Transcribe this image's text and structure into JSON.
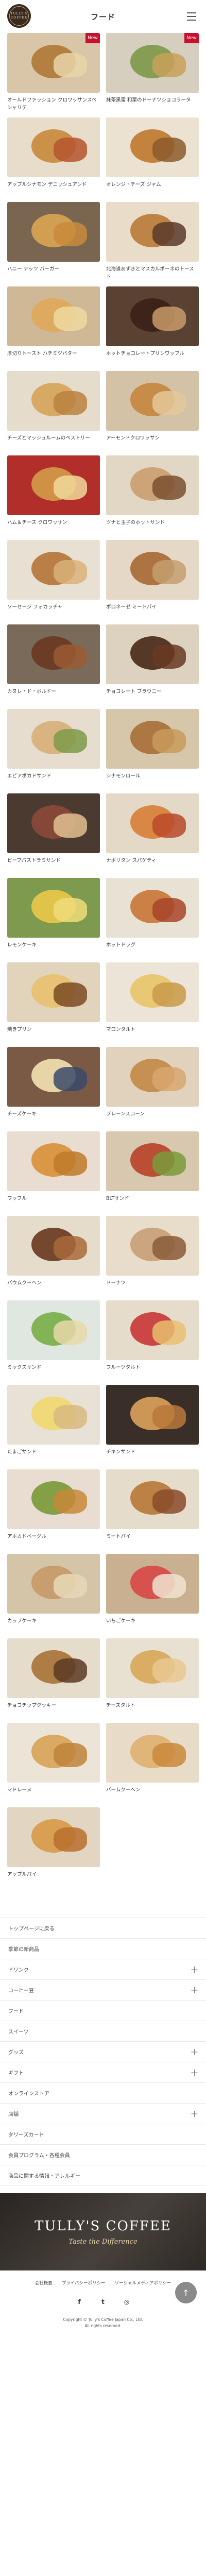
{
  "header": {
    "logo_text": "TULLY'S COFFEE",
    "title": "フード"
  },
  "products": [
    {
      "name": "オールドファッション クロワッサンスペシャリテ",
      "badge": "New",
      "bg": "#d9c6a8",
      "c1": "#b07a3a",
      "c2": "#e7d5a8"
    },
    {
      "name": "抹茶黒蜜 和栗のドーナツショコラータ",
      "badge": "New",
      "bg": "#d6cfbf",
      "c1": "#7e9a4a",
      "c2": "#c9a05a"
    },
    {
      "name": "アップルシナモン デニッシュアンド",
      "badge": "",
      "bg": "#e8dccb",
      "c1": "#c98a3e",
      "c2": "#b5552e"
    },
    {
      "name": "オレンジ・チーズ ジャム",
      "badge": "",
      "bg": "#ece2d2",
      "c1": "#c07a32",
      "c2": "#8c5a2a"
    },
    {
      "name": "ハニー ナッツ バーガー",
      "badge": "",
      "bg": "#7a6650",
      "c1": "#d8a452",
      "c2": "#c88a3a"
    },
    {
      "name": "北海道あずきとマスカルポーネのトースト",
      "badge": "",
      "bg": "#e9ddca",
      "c1": "#b87c3a",
      "c2": "#5a3a2a"
    },
    {
      "name": "厚切りトースト ハチミツバター",
      "badge": "",
      "bg": "#cfb896",
      "c1": "#e0a85a",
      "c2": "#f0d9a0"
    },
    {
      "name": "ホットチョコレートプリンワッフル",
      "badge": "",
      "bg": "#5a4232",
      "c1": "#3a2218",
      "c2": "#c89a6a"
    },
    {
      "name": "チーズとマッシュルームのペストリー",
      "badge": "",
      "bg": "#e6dccc",
      "c1": "#d7a45c",
      "c2": "#b8823e"
    },
    {
      "name": "アーモンドクロワッサン",
      "badge": "",
      "bg": "#d4c2a6",
      "c1": "#c48840",
      "c2": "#e4c89a"
    },
    {
      "name": "ハム＆チーズ クロワッサン",
      "badge": "",
      "bg": "#b22e2a",
      "c1": "#d39a4a",
      "c2": "#f1d89a"
    },
    {
      "name": "ツナと玉子のホットサンド",
      "badge": "",
      "bg": "#e2d6c4",
      "c1": "#caa070",
      "c2": "#7a5030"
    },
    {
      "name": "ソーセージ フォカッチャ",
      "badge": "",
      "bg": "#e8e0d2",
      "c1": "#b4763a",
      "c2": "#d9b27a"
    },
    {
      "name": "ボロネーゼ ミートパイ",
      "badge": "",
      "bg": "#e5d8c6",
      "c1": "#a86a34",
      "c2": "#c4a070"
    },
    {
      "name": "カヌレ・ド・ボルドー",
      "badge": "",
      "bg": "#7a6a5a",
      "c1": "#6a3a22",
      "c2": "#9a5a32"
    },
    {
      "name": "チョコレート ブラウニー",
      "badge": "",
      "bg": "#ddd2c0",
      "c1": "#4a2a1a",
      "c2": "#6a3a22"
    },
    {
      "name": "エビアボカドサンド",
      "badge": "",
      "bg": "#e6ddcf",
      "c1": "#d8b07a",
      "c2": "#7c9a4a"
    },
    {
      "name": "シナモンロール",
      "badge": "",
      "bg": "#d6c6aa",
      "c1": "#a8703a",
      "c2": "#c89a5a"
    },
    {
      "name": "ビーフパストラミサンド",
      "badge": "",
      "bg": "#4a3a30",
      "c1": "#8a4a3a",
      "c2": "#e0c090"
    },
    {
      "name": "ナポリタン スパゲティ",
      "badge": "",
      "bg": "#e4d8c6",
      "c1": "#d8803a",
      "c2": "#b84a2a"
    },
    {
      "name": "レモンケーキ",
      "badge": "",
      "bg": "#7e9a4e",
      "c1": "#e8c84a",
      "c2": "#f0dc7a"
    },
    {
      "name": "ホットドッグ",
      "badge": "",
      "bg": "#e8e2d4",
      "c1": "#c8783a",
      "c2": "#a8442a"
    },
    {
      "name": "焼きプリン",
      "badge": "",
      "bg": "#e2d4bc",
      "c1": "#e8c070",
      "c2": "#7a4a22"
    },
    {
      "name": "マロンタルト",
      "badge": "",
      "bg": "#ece4d6",
      "c1": "#e8c66a",
      "c2": "#c89a4a"
    },
    {
      "name": "チーズケーキ",
      "badge": "",
      "bg": "#7a5a44",
      "c1": "#f0e0b0",
      "c2": "#3a4a6a"
    },
    {
      "name": "プレーンスコーン",
      "badge": "",
      "bg": "#e0d2bc",
      "c1": "#c48a4a",
      "c2": "#d8a870"
    },
    {
      "name": "ワッフル",
      "badge": "",
      "bg": "#e8ddd0",
      "c1": "#d8903a",
      "c2": "#c07a2a"
    },
    {
      "name": "BLTサンド",
      "badge": "",
      "bg": "#d8c8b0",
      "c1": "#b8442a",
      "c2": "#7a9a3a"
    },
    {
      "name": "バウムクーヘン",
      "badge": "",
      "bg": "#e6dccc",
      "c1": "#6a3a22",
      "c2": "#a86a3a"
    },
    {
      "name": "ドーナツ",
      "badge": "",
      "bg": "#e8dccb",
      "c1": "#c8a07a",
      "c2": "#8a5a3a"
    },
    {
      "name": "ミックスサンド",
      "badge": "",
      "bg": "#e0e6e0",
      "c1": "#7ab04a",
      "c2": "#e8d8a8"
    },
    {
      "name": "フルーツタルト",
      "badge": "",
      "bg": "#e6dccc",
      "c1": "#c83a3a",
      "c2": "#e8c070"
    },
    {
      "name": "たまごサンド",
      "badge": "",
      "bg": "#e8e2d6",
      "c1": "#f0d870",
      "c2": "#d8b880"
    },
    {
      "name": "チキンサンド",
      "badge": "",
      "bg": "#3a2e28",
      "c1": "#d8a05a",
      "c2": "#b8783a"
    },
    {
      "name": "アボカドベーグル",
      "badge": "",
      "bg": "#e8ddd0",
      "c1": "#7a9a3a",
      "c2": "#c8883a"
    },
    {
      "name": "ミートパイ",
      "badge": "",
      "bg": "#e6dccc",
      "c1": "#b8783a",
      "c2": "#8a4a2a"
    },
    {
      "name": "カップケーキ",
      "badge": "",
      "bg": "#d4c4a8",
      "c1": "#c89a6a",
      "c2": "#e8d8b8"
    },
    {
      "name": "いちごケーキ",
      "badge": "",
      "bg": "#c8b090",
      "c1": "#d84a4a",
      "c2": "#f0e4d0"
    },
    {
      "name": "チョコチップクッキー",
      "badge": "",
      "bg": "#e6dccc",
      "c1": "#a8743a",
      "c2": "#5a3a22"
    },
    {
      "name": "チーズタルト",
      "badge": "",
      "bg": "#e8e0d0",
      "c1": "#d8a85a",
      "c2": "#e8c890"
    },
    {
      "name": "マドレーヌ",
      "badge": "",
      "bg": "#ece4d6",
      "c1": "#d8a45a",
      "c2": "#c0843a"
    },
    {
      "name": "バームクーヘン",
      "badge": "",
      "bg": "#e8dcc8",
      "c1": "#e0b070",
      "c2": "#c8883a"
    }
  ],
  "last_product": {
    "name": "アップルパイ",
    "badge": "",
    "bg": "#e2d6c2",
    "c1": "#d89a4a",
    "c2": "#b8702e"
  },
  "links": [
    {
      "label": "トップページに戻る",
      "chevron": false
    },
    {
      "label": "季節の新商品",
      "chevron": false
    },
    {
      "label": "ドリンク",
      "chevron": true
    },
    {
      "label": "コーヒー豆",
      "chevron": true
    },
    {
      "label": "フード",
      "chevron": false
    },
    {
      "label": "スイーツ",
      "chevron": false
    },
    {
      "label": "グッズ",
      "chevron": true
    },
    {
      "label": "ギフト",
      "chevron": true
    },
    {
      "label": "オンラインストア",
      "chevron": false
    },
    {
      "label": "店舗",
      "chevron": true
    },
    {
      "label": "タリーズカード",
      "chevron": false
    },
    {
      "label": "会員プログラム・各種会員",
      "chevron": false
    },
    {
      "label": "商品に関する情報・アレルギー",
      "chevron": false
    }
  ],
  "banner": {
    "title": "TULLY'S COFFEE",
    "subtitle": "Taste the Difference"
  },
  "footer": {
    "links": [
      "会社概要",
      "プライバシーポリシー",
      "ソーシャルメディアポリシー"
    ],
    "sns": [
      "f",
      "t",
      "◎"
    ],
    "copyright": "Copyright © Tully's Coffee Japan Co., Ltd.",
    "rights": "All rights reserved.",
    "pagetop": "↑"
  }
}
